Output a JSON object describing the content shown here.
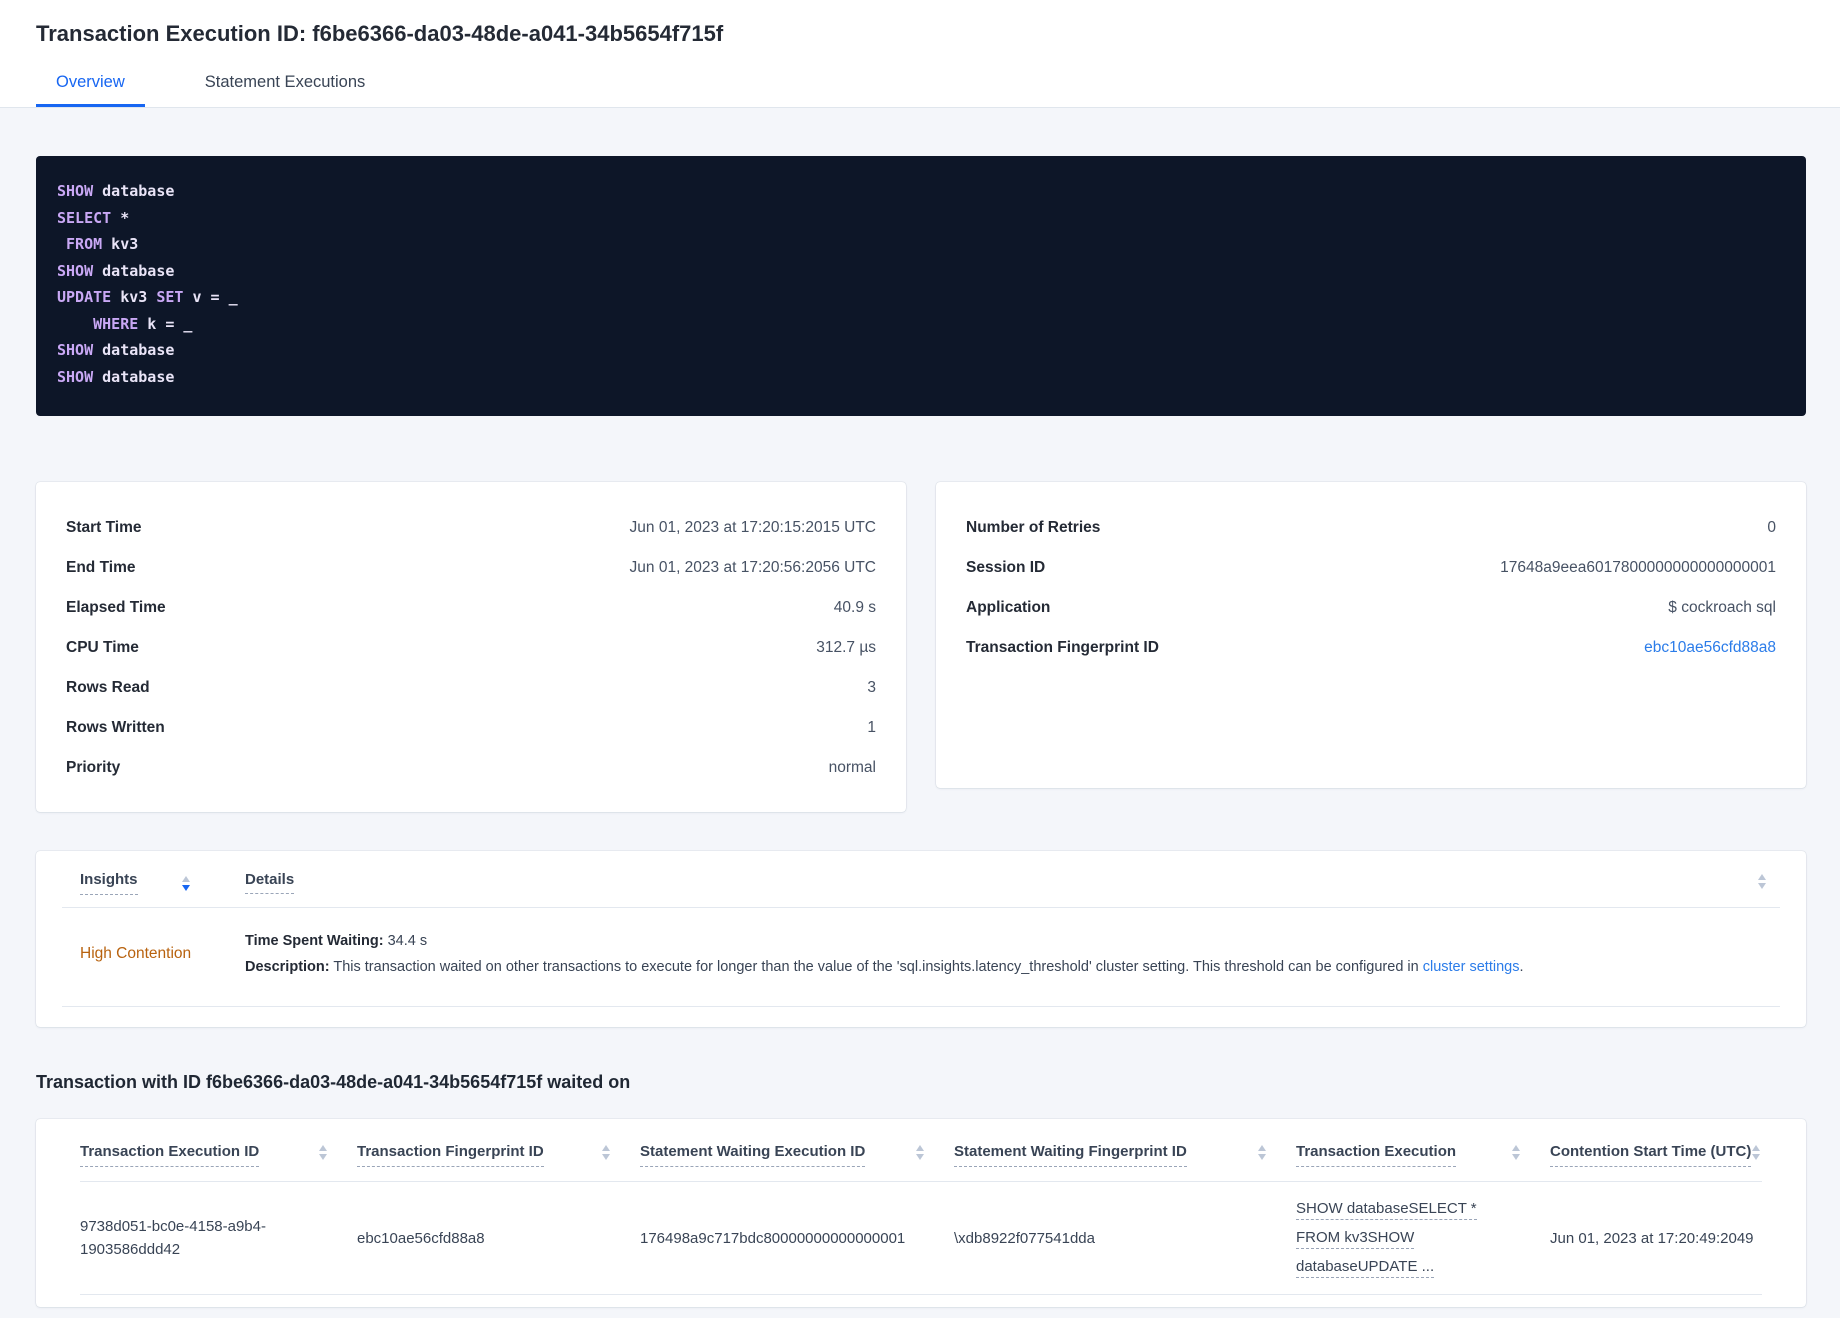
{
  "header": {
    "title": "Transaction Execution ID: f6be6366-da03-48de-a041-34b5654f715f",
    "tabs": [
      {
        "label": "Overview"
      },
      {
        "label": "Statement Executions"
      }
    ]
  },
  "sql": {
    "lines": [
      [
        {
          "t": "SHOW",
          "kw": true
        },
        {
          "t": " database",
          "kw": false
        }
      ],
      [
        {
          "t": "SELECT",
          "kw": true
        },
        {
          "t": " *",
          "kw": false
        }
      ],
      [
        {
          "t": " ",
          "kw": false
        },
        {
          "t": "FROM",
          "kw": true
        },
        {
          "t": " kv3",
          "kw": false
        }
      ],
      [
        {
          "t": "SHOW",
          "kw": true
        },
        {
          "t": " database",
          "kw": false
        }
      ],
      [
        {
          "t": "UPDATE",
          "kw": true
        },
        {
          "t": " kv3 ",
          "kw": false
        },
        {
          "t": "SET",
          "kw": true
        },
        {
          "t": " v = _",
          "kw": false
        }
      ],
      [
        {
          "t": "    ",
          "kw": false
        },
        {
          "t": "WHERE",
          "kw": true
        },
        {
          "t": " k = _",
          "kw": false
        }
      ],
      [
        {
          "t": "SHOW",
          "kw": true
        },
        {
          "t": " database",
          "kw": false
        }
      ],
      [
        {
          "t": "SHOW",
          "kw": true
        },
        {
          "t": " database",
          "kw": false
        }
      ]
    ]
  },
  "cards": {
    "execution": {
      "rows": [
        {
          "label": "Start Time",
          "value": "Jun 01, 2023 at 17:20:15:2015 UTC"
        },
        {
          "label": "End Time",
          "value": "Jun 01, 2023 at 17:20:56:2056 UTC"
        },
        {
          "label": "Elapsed Time",
          "value": "40.9 s"
        },
        {
          "label": "CPU Time",
          "value": "312.7 µs"
        },
        {
          "label": "Rows Read",
          "value": "3"
        },
        {
          "label": "Rows Written",
          "value": "1"
        },
        {
          "label": "Priority",
          "value": "normal"
        }
      ]
    },
    "session": {
      "rows": [
        {
          "label": "Number of Retries",
          "value": "0"
        },
        {
          "label": "Session ID",
          "value": "17648a9eea6017800000000000000001"
        },
        {
          "label": "Application",
          "value": "$ cockroach sql"
        }
      ],
      "fingerprint": {
        "label": "Transaction Fingerprint ID",
        "value": "ebc10ae56cfd88a8"
      }
    }
  },
  "insights": {
    "columns": [
      "Insights",
      "Details"
    ],
    "row": {
      "insight": "High Contention",
      "waiting_label": "Time Spent Waiting:",
      "waiting_value": " 34.4 s",
      "description_label": "Description:",
      "description_text": " This transaction waited on other transactions to execute for longer than the value of the 'sql.insights.latency_threshold' cluster setting. This threshold can be configured in ",
      "description_link": "cluster settings",
      "description_suffix": "."
    }
  },
  "waited": {
    "heading": "Transaction with ID f6be6366-da03-48de-a041-34b5654f715f waited on",
    "columns": [
      "Transaction Execution ID",
      "Transaction Fingerprint ID",
      "Statement Waiting Execution ID",
      "Statement Waiting Fingerprint ID",
      "Transaction Execution",
      "Contention Start Time (UTC)"
    ],
    "row": {
      "transaction_execution_id": "9738d051-bc0e-4158-a9b4-1903586ddd42",
      "transaction_fingerprint_id": "ebc10ae56cfd88a8",
      "statement_waiting_execution_id": "176498a9c717bdc80000000000000001",
      "statement_waiting_fingerprint_id": "\\xdb8922f077541dda",
      "transaction_execution_lines": [
        "SHOW databaseSELECT *",
        "FROM kv3SHOW",
        "databaseUPDATE ..."
      ],
      "contention_start_time": "Jun 01, 2023 at 17:20:49:2049"
    }
  },
  "colors": {
    "accent_blue": "#1766f2",
    "link_blue": "#2b7ce9",
    "insight_orange": "#b8620e",
    "code_background": "#0d1628",
    "code_keyword": "#c9a8f5",
    "code_plain": "#e9e4f7"
  }
}
